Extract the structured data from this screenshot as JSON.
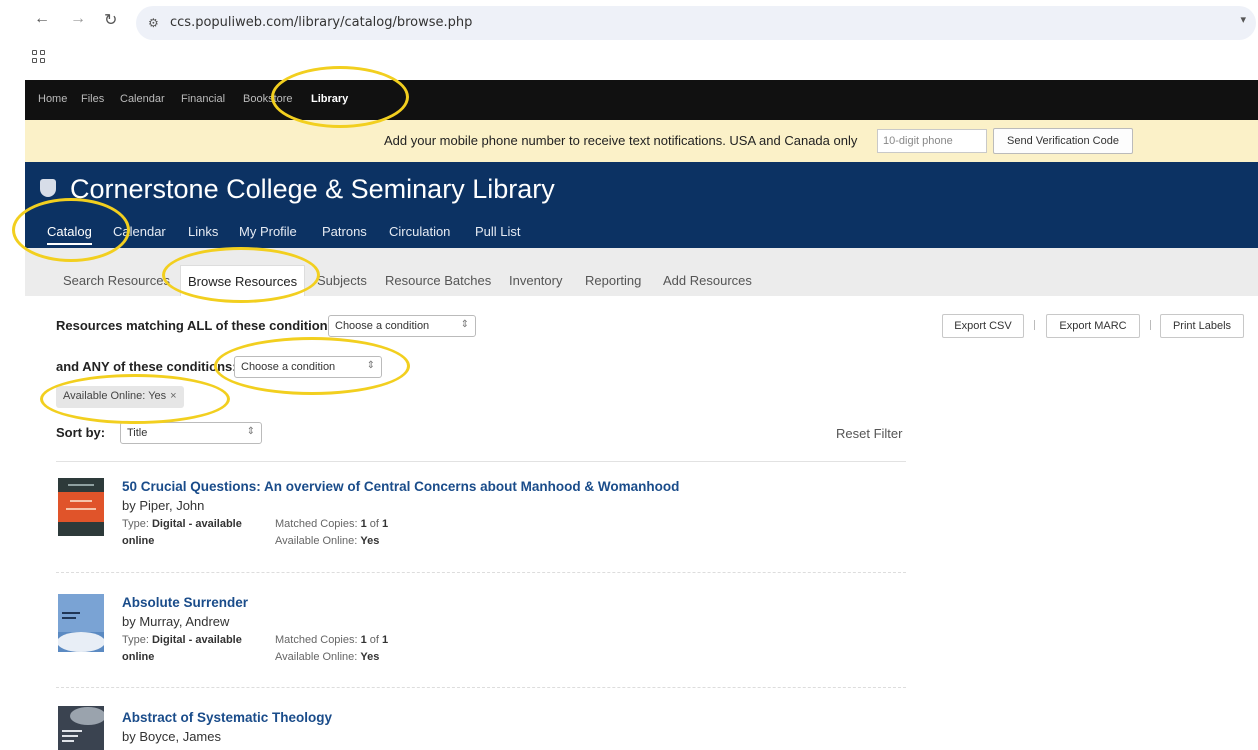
{
  "browser": {
    "url": "ccs.populiweb.com/library/catalog/browse.php"
  },
  "top_nav": {
    "items": [
      "Home",
      "Files",
      "Calendar",
      "Financial",
      "Bookstore",
      "Library"
    ],
    "active": "Library"
  },
  "notice": {
    "text": "Add your mobile phone number to receive text notifications. USA and Canada only",
    "phone_placeholder": "10-digit phone",
    "button_label": "Send Verification Code"
  },
  "library": {
    "title": "Cornerstone College & Seminary Library",
    "nav": [
      "Catalog",
      "Calendar",
      "Links",
      "My Profile",
      "Patrons",
      "Circulation",
      "Pull List"
    ],
    "active": "Catalog"
  },
  "sub_nav": {
    "items": [
      "Search Resources",
      "Browse Resources",
      "Subjects",
      "Resource Batches",
      "Inventory",
      "Reporting",
      "Add Resources"
    ],
    "active": "Browse Resources"
  },
  "filters": {
    "all_label": "Resources matching ALL of these conditions:",
    "all_select": "Choose a condition",
    "any_label": "and ANY of these conditions:",
    "any_select": "Choose a condition",
    "active_tag": "Available Online: Yes",
    "sort_label": "Sort by:",
    "sort_value": "Title",
    "reset_label": "Reset Filter"
  },
  "export": {
    "csv": "Export CSV",
    "marc": "Export MARC",
    "labels": "Print Labels"
  },
  "meta_labels": {
    "type": "Type:",
    "matched": "Matched Copies:",
    "available": "Available Online:"
  },
  "results": [
    {
      "title": "50 Crucial Questions: An overview of Central Concerns about Manhood & Womanhood",
      "author": "by Piper, John",
      "type_value": "Digital - available",
      "type_value2": "online",
      "matched": "1",
      "matched_of": "of",
      "matched_total": "1",
      "available": "Yes",
      "thumb_color": "#2d3a3a",
      "thumb_accent": "#e0542a"
    },
    {
      "title": "Absolute Surrender",
      "author": "by Murray, Andrew",
      "type_value": "Digital - available",
      "type_value2": "online",
      "matched": "1",
      "matched_of": "of",
      "matched_total": "1",
      "available": "Yes",
      "thumb_color": "#5b8ac2",
      "thumb_accent": "#e8eef6"
    },
    {
      "title": "Abstract of Systematic Theology",
      "author": "by Boyce, James",
      "thumb_color": "#3a4350",
      "thumb_accent": "#9aa3ad"
    }
  ],
  "colors": {
    "top_nav_bg": "#111111",
    "notice_bg": "#fbf1c8",
    "library_header_bg": "#0c3263",
    "link_color": "#1a4c8a",
    "highlight": "#f2cf1f"
  }
}
